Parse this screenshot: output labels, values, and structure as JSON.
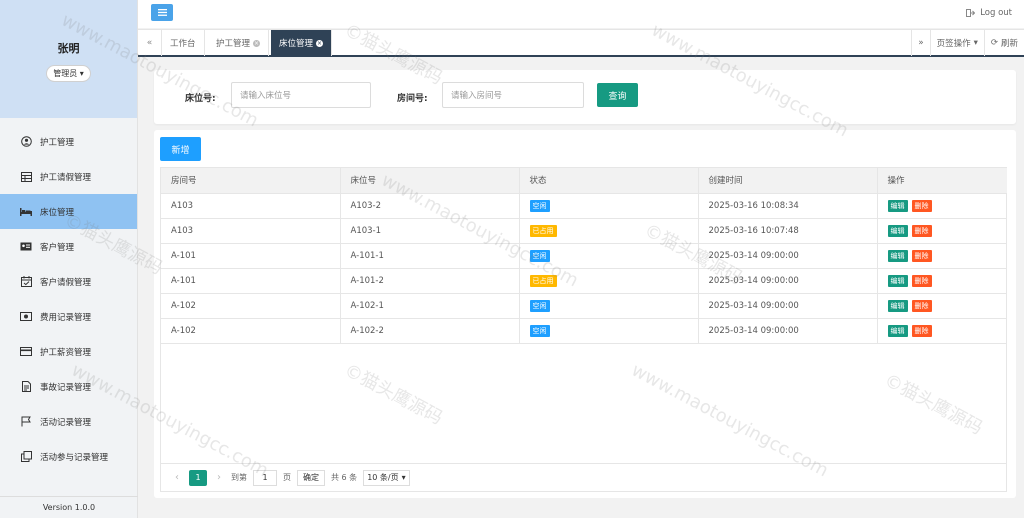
{
  "sidebar": {
    "user_name": "张明",
    "role": "管理员",
    "items": [
      {
        "label": "护工管理",
        "icon": "user-circle-icon",
        "active": false
      },
      {
        "label": "护工请假管理",
        "icon": "table-icon",
        "active": false
      },
      {
        "label": "床位管理",
        "icon": "bed-icon",
        "active": true
      },
      {
        "label": "客户管理",
        "icon": "id-card-icon",
        "active": false
      },
      {
        "label": "客户请假管理",
        "icon": "calendar-check-icon",
        "active": false
      },
      {
        "label": "费用记录管理",
        "icon": "money-icon",
        "active": false
      },
      {
        "label": "护工薪资管理",
        "icon": "credit-card-icon",
        "active": false
      },
      {
        "label": "事故记录管理",
        "icon": "document-icon",
        "active": false
      },
      {
        "label": "活动记录管理",
        "icon": "flag-icon",
        "active": false
      },
      {
        "label": "活动参与记录管理",
        "icon": "copy-icon",
        "active": false
      }
    ],
    "version": "Version 1.0.0"
  },
  "topbar": {
    "logout_label": "Log out"
  },
  "tabs": {
    "items": [
      {
        "label": "工作台",
        "closable": false,
        "active": false
      },
      {
        "label": "护工管理",
        "closable": true,
        "active": false
      },
      {
        "label": "床位管理",
        "closable": true,
        "active": true
      }
    ],
    "page_ops_label": "页签操作",
    "refresh_label": "刷新"
  },
  "search": {
    "bed_label": "床位号:",
    "bed_placeholder": "请输入床位号",
    "room_label": "房间号:",
    "room_placeholder": "请输入房间号",
    "query_label": "查询"
  },
  "toolbar": {
    "add_label": "新增"
  },
  "table": {
    "columns": [
      "房间号",
      "床位号",
      "状态",
      "创建时间",
      "操作"
    ],
    "rows": [
      {
        "room": "A103",
        "bed": "A103-2",
        "status": "空闲",
        "status_type": "free",
        "created": "2025-03-16 10:08:34"
      },
      {
        "room": "A103",
        "bed": "A103-1",
        "status": "已占用",
        "status_type": "occupied",
        "created": "2025-03-16 10:07:48"
      },
      {
        "room": "A-101",
        "bed": "A-101-1",
        "status": "空闲",
        "status_type": "free",
        "created": "2025-03-14 09:00:00"
      },
      {
        "room": "A-101",
        "bed": "A-101-2",
        "status": "已占用",
        "status_type": "occupied",
        "created": "2025-03-14 09:00:00"
      },
      {
        "room": "A-102",
        "bed": "A-102-1",
        "status": "空闲",
        "status_type": "free",
        "created": "2025-03-14 09:00:00"
      },
      {
        "room": "A-102",
        "bed": "A-102-2",
        "status": "空闲",
        "status_type": "free",
        "created": "2025-03-14 09:00:00"
      }
    ],
    "edit_label": "编辑",
    "delete_label": "删除"
  },
  "pager": {
    "current_page": "1",
    "goto_label": "到第",
    "goto_value": "1",
    "page_unit": "页",
    "confirm_label": "确定",
    "total_label": "共 6 条",
    "page_size": "10 条/页"
  },
  "colors": {
    "accent_blue": "#1e9fff",
    "accent_green": "#169a82",
    "status_free": "#1e9fff",
    "status_occupied": "#ffb800",
    "delete_red": "#ff5722",
    "active_nav": "#8fc2f2"
  },
  "watermark": {
    "text_cn": "©猫头鹰源码",
    "text_url": "www.maotouyingcc.com"
  }
}
